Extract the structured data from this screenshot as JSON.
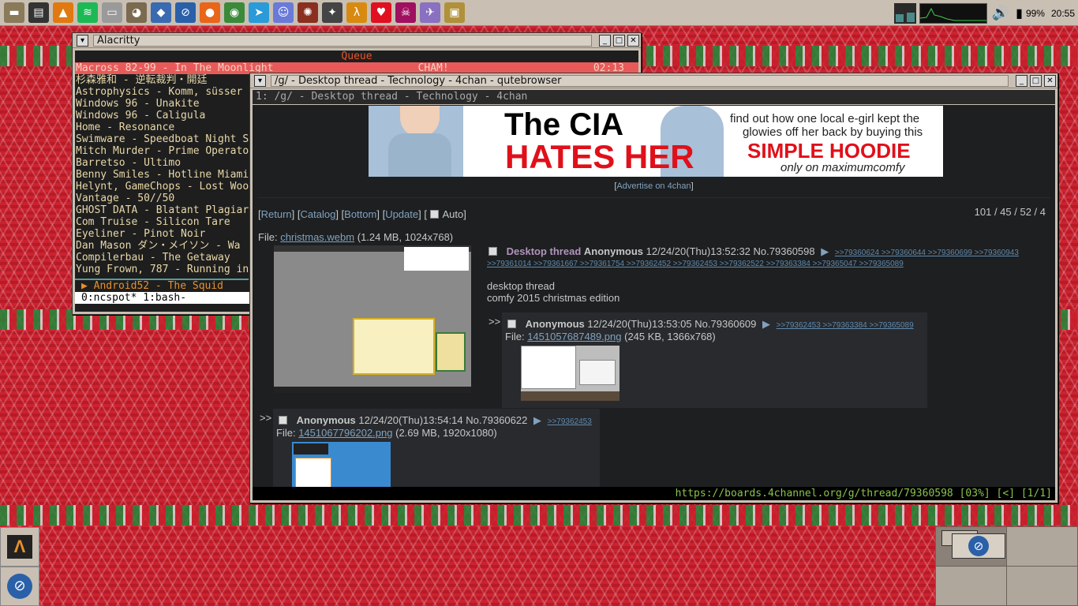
{
  "taskbar": {
    "launchers": [
      {
        "name": "file-manager-icon",
        "glyph": "▬",
        "bg": "#8a7a5a"
      },
      {
        "name": "terminal-icon",
        "glyph": "▤",
        "bg": "#333333"
      },
      {
        "name": "vlc-icon",
        "glyph": "▲",
        "bg": "#e07a10"
      },
      {
        "name": "spotify-icon",
        "glyph": "≋",
        "bg": "#1db954"
      },
      {
        "name": "drive-icon",
        "glyph": "▭",
        "bg": "#9a9a9a"
      },
      {
        "name": "gimp-icon",
        "glyph": "◕",
        "bg": "#7a6a50"
      },
      {
        "name": "cube-icon",
        "glyph": "◆",
        "bg": "#3a6ab0"
      },
      {
        "name": "app-logo-icon",
        "glyph": "⊘",
        "bg": "#2a60a8"
      },
      {
        "name": "firefox-icon",
        "glyph": "●",
        "bg": "#e8651a"
      },
      {
        "name": "chrome-icon",
        "glyph": "◉",
        "bg": "#3a8a3a"
      },
      {
        "name": "telegram-icon",
        "glyph": "➤",
        "bg": "#2a9ad8"
      },
      {
        "name": "discord-icon",
        "glyph": "☺",
        "bg": "#6a7ad8"
      },
      {
        "name": "game-emblem-icon",
        "glyph": "✺",
        "bg": "#8a3020"
      },
      {
        "name": "cs-icon",
        "glyph": "✦",
        "bg": "#444444"
      },
      {
        "name": "half-life-icon",
        "glyph": "λ",
        "bg": "#d88a10"
      },
      {
        "name": "heart-icon",
        "glyph": "♥",
        "bg": "#e01020"
      },
      {
        "name": "skull-icon",
        "glyph": "☠",
        "bg": "#a01060"
      },
      {
        "name": "flying-icon",
        "glyph": "✈",
        "bg": "#8a70c0"
      },
      {
        "name": "dosbox-icon",
        "glyph": "▣",
        "bg": "#b0903a"
      }
    ],
    "battery": "99%",
    "time": "20:55"
  },
  "alacritty": {
    "title": "Alacritty",
    "queue_header": "Queue",
    "now_playing": {
      "track": "Macross 82-99 - In The Moonlight",
      "status": "CHAM!",
      "time": "02:13"
    },
    "tracks": [
      "杉森雅和 - 逆転裁判・開廷",
      "Astrophysics - Komm, süsser",
      "Windows 96 - Unakite",
      "Windows 96 - Caligula",
      "Home - Resonance",
      "Swimware - Speedboat Night S",
      "Mitch Murder - Prime Operato",
      "Barretso - Ultimo",
      "Benny Smiles - Hotline Miami",
      "Helynt, GameChops - Lost Woo",
      "Vantage - 50//50",
      "GHOST DATA - Blatant Plagiar",
      "Com Truise - Silicon Tare",
      "Eyeliner - Pinot Noir",
      "Dan Mason ダン・メイソン - Wa",
      "Compilerbau - The Getaway",
      "Yung Frown, 787 - Running in"
    ],
    "playing_line": "▶  Android52 - The Squid",
    "tmux_line": "0:ncspot* 1:bash-"
  },
  "qutebrowser": {
    "title": "/g/ - Desktop thread - Technology - 4chan - qutebrowser",
    "tab": "1: /g/ - Desktop thread - Technology - 4chan",
    "ad": {
      "line1": "The CIA",
      "line2": "HATES HER",
      "right1": "find out how one local e-girl kept the",
      "right2": "glowies off her back by buying this",
      "right3": "SIMPLE HOODIE",
      "right4": "only on maximumcomfy"
    },
    "advertise": "Advertise on 4chan",
    "nav": {
      "return": "Return",
      "catalog": "Catalog",
      "bottom": "Bottom",
      "update": "Update",
      "auto": "Auto"
    },
    "stats": "101 / 45 / 52 / 4",
    "op": {
      "file_label": "File:",
      "file": "christmas.webm",
      "file_info": "(1.24 MB, 1024x768)",
      "subject": "Desktop thread",
      "name": "Anonymous",
      "date": "12/24/20(Thu)13:52:32",
      "no": "No.79360598",
      "quotes1": ">>79360624 >>79360644 >>79360699 >>79360943",
      "quotes2": ">>79361014 >>79361667 >>79361754 >>79362452 >>79362453 >>79362522 >>79363384 >>79365047 >>79365089",
      "text1": "desktop thread",
      "text2": "comfy 2015 christmas edition"
    },
    "reply1": {
      "arrow": ">>",
      "name": "Anonymous",
      "date": "12/24/20(Thu)13:53:05",
      "no": "No.79360609",
      "quotes": ">>79362453 >>79363384 >>79365089",
      "file_label": "File:",
      "file": "1451057687489.png",
      "file_info": "(245 KB, 1366x768)"
    },
    "reply2": {
      "arrow": ">>",
      "name": "Anonymous",
      "date": "12/24/20(Thu)13:54:14",
      "no": "No.79360622",
      "quotes": ">>79362453",
      "file_label": "File:",
      "file": "1451067796202.png",
      "file_info": "(2.69 MB, 1920x1080)"
    },
    "status": "https://boards.4channel.org/g/thread/79360598 [03%] [<] [1/1]"
  },
  "colors": {
    "accent": "#b294bb",
    "link": "#81a2be",
    "status_green": "#8ac34a"
  }
}
